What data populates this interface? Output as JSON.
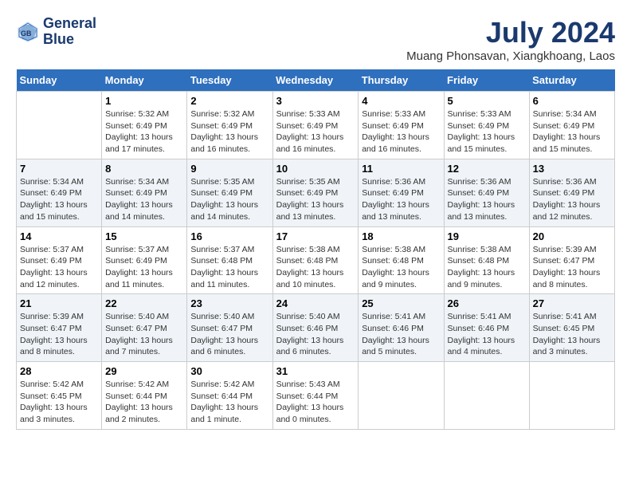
{
  "logo": {
    "line1": "General",
    "line2": "Blue"
  },
  "title": "July 2024",
  "subtitle": "Muang Phonsavan, Xiangkhoang, Laos",
  "days_header": [
    "Sunday",
    "Monday",
    "Tuesday",
    "Wednesday",
    "Thursday",
    "Friday",
    "Saturday"
  ],
  "weeks": [
    [
      {
        "num": "",
        "sunrise": "",
        "sunset": "",
        "daylight": ""
      },
      {
        "num": "1",
        "sunrise": "Sunrise: 5:32 AM",
        "sunset": "Sunset: 6:49 PM",
        "daylight": "Daylight: 13 hours and 17 minutes."
      },
      {
        "num": "2",
        "sunrise": "Sunrise: 5:32 AM",
        "sunset": "Sunset: 6:49 PM",
        "daylight": "Daylight: 13 hours and 16 minutes."
      },
      {
        "num": "3",
        "sunrise": "Sunrise: 5:33 AM",
        "sunset": "Sunset: 6:49 PM",
        "daylight": "Daylight: 13 hours and 16 minutes."
      },
      {
        "num": "4",
        "sunrise": "Sunrise: 5:33 AM",
        "sunset": "Sunset: 6:49 PM",
        "daylight": "Daylight: 13 hours and 16 minutes."
      },
      {
        "num": "5",
        "sunrise": "Sunrise: 5:33 AM",
        "sunset": "Sunset: 6:49 PM",
        "daylight": "Daylight: 13 hours and 15 minutes."
      },
      {
        "num": "6",
        "sunrise": "Sunrise: 5:34 AM",
        "sunset": "Sunset: 6:49 PM",
        "daylight": "Daylight: 13 hours and 15 minutes."
      }
    ],
    [
      {
        "num": "7",
        "sunrise": "Sunrise: 5:34 AM",
        "sunset": "Sunset: 6:49 PM",
        "daylight": "Daylight: 13 hours and 15 minutes."
      },
      {
        "num": "8",
        "sunrise": "Sunrise: 5:34 AM",
        "sunset": "Sunset: 6:49 PM",
        "daylight": "Daylight: 13 hours and 14 minutes."
      },
      {
        "num": "9",
        "sunrise": "Sunrise: 5:35 AM",
        "sunset": "Sunset: 6:49 PM",
        "daylight": "Daylight: 13 hours and 14 minutes."
      },
      {
        "num": "10",
        "sunrise": "Sunrise: 5:35 AM",
        "sunset": "Sunset: 6:49 PM",
        "daylight": "Daylight: 13 hours and 13 minutes."
      },
      {
        "num": "11",
        "sunrise": "Sunrise: 5:36 AM",
        "sunset": "Sunset: 6:49 PM",
        "daylight": "Daylight: 13 hours and 13 minutes."
      },
      {
        "num": "12",
        "sunrise": "Sunrise: 5:36 AM",
        "sunset": "Sunset: 6:49 PM",
        "daylight": "Daylight: 13 hours and 13 minutes."
      },
      {
        "num": "13",
        "sunrise": "Sunrise: 5:36 AM",
        "sunset": "Sunset: 6:49 PM",
        "daylight": "Daylight: 13 hours and 12 minutes."
      }
    ],
    [
      {
        "num": "14",
        "sunrise": "Sunrise: 5:37 AM",
        "sunset": "Sunset: 6:49 PM",
        "daylight": "Daylight: 13 hours and 12 minutes."
      },
      {
        "num": "15",
        "sunrise": "Sunrise: 5:37 AM",
        "sunset": "Sunset: 6:49 PM",
        "daylight": "Daylight: 13 hours and 11 minutes."
      },
      {
        "num": "16",
        "sunrise": "Sunrise: 5:37 AM",
        "sunset": "Sunset: 6:48 PM",
        "daylight": "Daylight: 13 hours and 11 minutes."
      },
      {
        "num": "17",
        "sunrise": "Sunrise: 5:38 AM",
        "sunset": "Sunset: 6:48 PM",
        "daylight": "Daylight: 13 hours and 10 minutes."
      },
      {
        "num": "18",
        "sunrise": "Sunrise: 5:38 AM",
        "sunset": "Sunset: 6:48 PM",
        "daylight": "Daylight: 13 hours and 9 minutes."
      },
      {
        "num": "19",
        "sunrise": "Sunrise: 5:38 AM",
        "sunset": "Sunset: 6:48 PM",
        "daylight": "Daylight: 13 hours and 9 minutes."
      },
      {
        "num": "20",
        "sunrise": "Sunrise: 5:39 AM",
        "sunset": "Sunset: 6:47 PM",
        "daylight": "Daylight: 13 hours and 8 minutes."
      }
    ],
    [
      {
        "num": "21",
        "sunrise": "Sunrise: 5:39 AM",
        "sunset": "Sunset: 6:47 PM",
        "daylight": "Daylight: 13 hours and 8 minutes."
      },
      {
        "num": "22",
        "sunrise": "Sunrise: 5:40 AM",
        "sunset": "Sunset: 6:47 PM",
        "daylight": "Daylight: 13 hours and 7 minutes."
      },
      {
        "num": "23",
        "sunrise": "Sunrise: 5:40 AM",
        "sunset": "Sunset: 6:47 PM",
        "daylight": "Daylight: 13 hours and 6 minutes."
      },
      {
        "num": "24",
        "sunrise": "Sunrise: 5:40 AM",
        "sunset": "Sunset: 6:46 PM",
        "daylight": "Daylight: 13 hours and 6 minutes."
      },
      {
        "num": "25",
        "sunrise": "Sunrise: 5:41 AM",
        "sunset": "Sunset: 6:46 PM",
        "daylight": "Daylight: 13 hours and 5 minutes."
      },
      {
        "num": "26",
        "sunrise": "Sunrise: 5:41 AM",
        "sunset": "Sunset: 6:46 PM",
        "daylight": "Daylight: 13 hours and 4 minutes."
      },
      {
        "num": "27",
        "sunrise": "Sunrise: 5:41 AM",
        "sunset": "Sunset: 6:45 PM",
        "daylight": "Daylight: 13 hours and 3 minutes."
      }
    ],
    [
      {
        "num": "28",
        "sunrise": "Sunrise: 5:42 AM",
        "sunset": "Sunset: 6:45 PM",
        "daylight": "Daylight: 13 hours and 3 minutes."
      },
      {
        "num": "29",
        "sunrise": "Sunrise: 5:42 AM",
        "sunset": "Sunset: 6:44 PM",
        "daylight": "Daylight: 13 hours and 2 minutes."
      },
      {
        "num": "30",
        "sunrise": "Sunrise: 5:42 AM",
        "sunset": "Sunset: 6:44 PM",
        "daylight": "Daylight: 13 hours and 1 minute."
      },
      {
        "num": "31",
        "sunrise": "Sunrise: 5:43 AM",
        "sunset": "Sunset: 6:44 PM",
        "daylight": "Daylight: 13 hours and 0 minutes."
      },
      {
        "num": "",
        "sunrise": "",
        "sunset": "",
        "daylight": ""
      },
      {
        "num": "",
        "sunrise": "",
        "sunset": "",
        "daylight": ""
      },
      {
        "num": "",
        "sunrise": "",
        "sunset": "",
        "daylight": ""
      }
    ]
  ]
}
